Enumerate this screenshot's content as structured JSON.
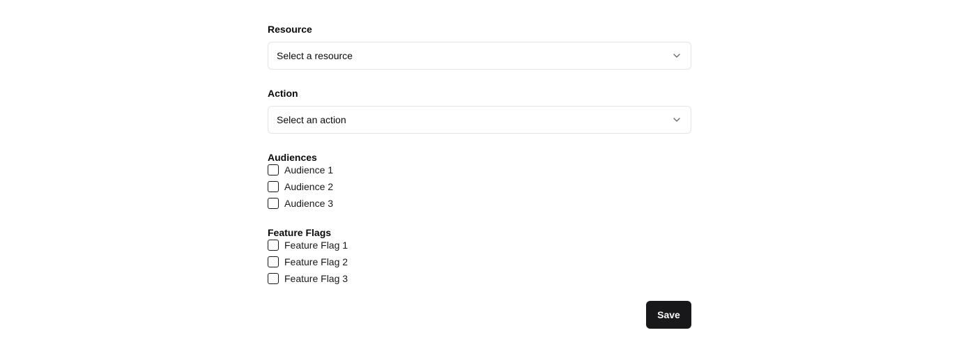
{
  "resource": {
    "label": "Resource",
    "placeholder": "Select a resource",
    "icon": "chevron-down-icon"
  },
  "action": {
    "label": "Action",
    "placeholder": "Select an action",
    "icon": "chevron-down-icon"
  },
  "audiences": {
    "label": "Audiences",
    "items": [
      {
        "label": "Audience 1",
        "checked": false
      },
      {
        "label": "Audience 2",
        "checked": false
      },
      {
        "label": "Audience 3",
        "checked": false
      }
    ]
  },
  "feature_flags": {
    "label": "Feature Flags",
    "items": [
      {
        "label": "Feature Flag 1",
        "checked": false
      },
      {
        "label": "Feature Flag 2",
        "checked": false
      },
      {
        "label": "Feature Flag 3",
        "checked": false
      }
    ]
  },
  "save_label": "Save",
  "colors": {
    "button_bg": "#18181b",
    "button_text": "#fafafa",
    "border": "#e4e4e7"
  }
}
